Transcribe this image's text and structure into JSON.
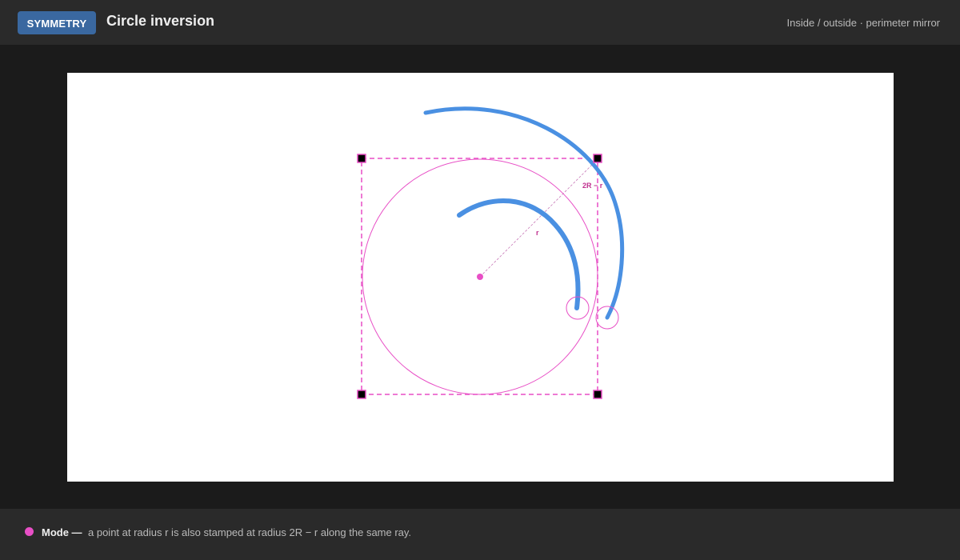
{
  "header": {
    "badge": "SYMMETRY",
    "title": "Circle inversion",
    "subtitle": "Inside / outside · perimeter mirror"
  },
  "canvas": {
    "labels": {
      "radius": "r",
      "mirror_radius": "2R − r"
    },
    "colors": {
      "guide": "#e84fc6",
      "stroke": "#4a90e2",
      "handle": "#000000"
    },
    "icons": [
      "center-point-icon",
      "handle-square-icon",
      "cursor-ring-icon"
    ]
  },
  "footer": {
    "label": "Mode —",
    "text": "a point at radius r is also stamped at radius 2R − r along the same ray."
  }
}
